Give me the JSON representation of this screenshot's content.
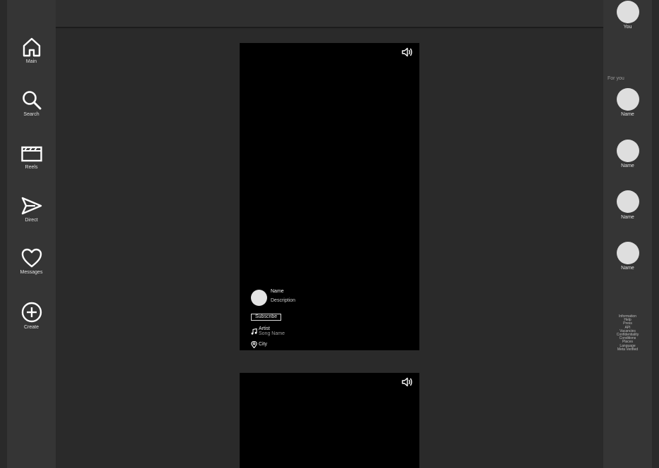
{
  "sidebar": {
    "items": [
      {
        "label": "Main",
        "icon": "home-icon"
      },
      {
        "label": "Search",
        "icon": "search-icon"
      },
      {
        "label": "Reels",
        "icon": "clapperboard-icon"
      },
      {
        "label": "Direct",
        "icon": "send-icon"
      },
      {
        "label": "Messages",
        "icon": "heart-icon"
      },
      {
        "label": "Create",
        "icon": "plus-circle-icon"
      }
    ]
  },
  "reel": {
    "name": "Name",
    "description": "Description",
    "subscribe_label": "Subscribe",
    "artist": "Artist",
    "song": "Song Name",
    "city": "City"
  },
  "rightbar": {
    "you_label": "You",
    "for_you_label": "For you",
    "suggestions": [
      "Name",
      "Name",
      "Name",
      "Name"
    ],
    "footer_links": [
      "Information",
      "Help",
      "Press",
      "API",
      "Vacancies",
      "Confidentiality",
      "Conditions",
      "Places",
      "Language",
      "Meta Verified"
    ]
  },
  "colors": {
    "background": "#2a2a2a",
    "panel": "#353535",
    "reel": "#000000"
  }
}
